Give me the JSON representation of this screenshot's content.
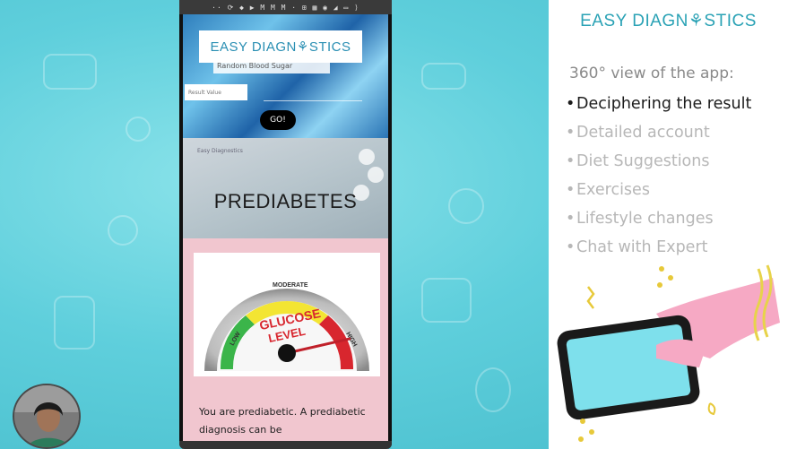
{
  "app": {
    "status_bar": "·· ⟳ ◆ ▶ M M M · ⊞ ▦ ◉ ◢ ▭ ⟩",
    "logo_text": "EASY  DIAGN⚘STICS",
    "test_name": "Random Blood Sugar",
    "result_placeholder": "Result Value",
    "go_label": "GO!",
    "panel_small": "Easy Diagnostics",
    "diagnosis": "PREDIABETES",
    "gauge": {
      "moderate": "MODERATE",
      "low": "LOW",
      "high": "HIGH",
      "glucose": "GLUCOSE",
      "level": "LEVEL",
      "level_fraction": 0.92
    },
    "result_text": "You are prediabetic. A prediabetic diagnosis can be"
  },
  "slide": {
    "logo_text": "EASY  DIAGN⚘STICS",
    "subtitle": "360° view of the app:",
    "features": [
      {
        "label": "Deciphering the result",
        "active": true
      },
      {
        "label": "Detailed account",
        "active": false
      },
      {
        "label": "Diet Suggestions",
        "active": false
      },
      {
        "label": "Exercises",
        "active": false
      },
      {
        "label": "Lifestyle changes",
        "active": false
      },
      {
        "label": "Chat with Expert",
        "active": false
      }
    ],
    "bullet": "•"
  },
  "colors": {
    "background": "#58c7d6",
    "brand": "#2aa2b5",
    "card_pink": "#f1c6cf",
    "gauge_green": "#3bb54a",
    "gauge_yellow": "#f3e533",
    "gauge_red": "#d8262e"
  },
  "icons": [
    "stethoscope-heart-icon",
    "hand-holding-phone-icon",
    "webcam-avatar"
  ]
}
